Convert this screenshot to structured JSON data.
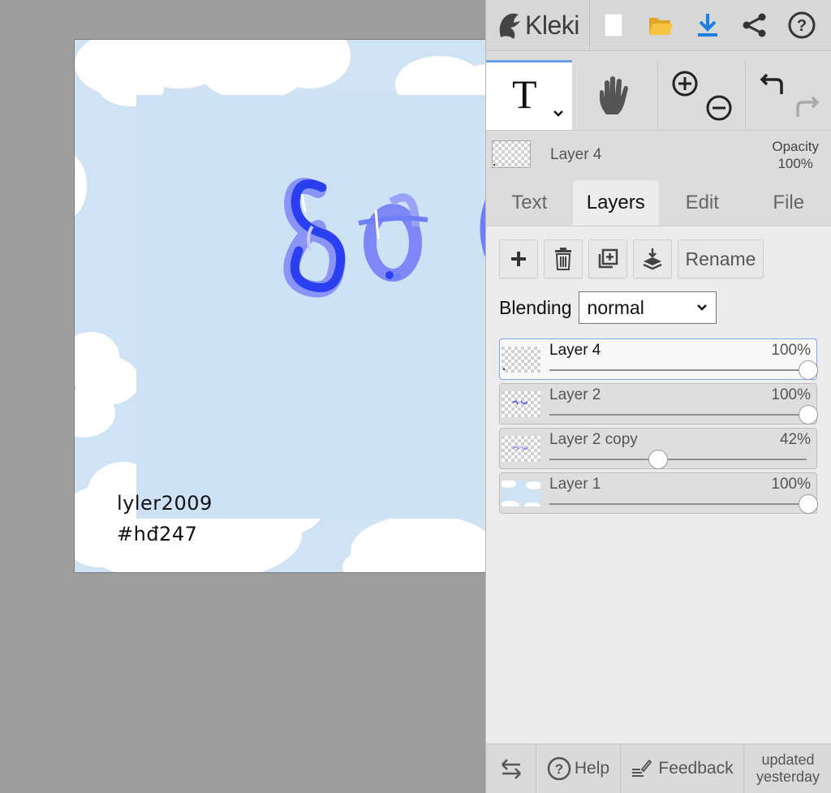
{
  "app": {
    "name": "Kleki"
  },
  "canvas": {
    "signature_line1": "lyler2009",
    "signature_line2": "#hđ247",
    "background_color": "#cfe3f5"
  },
  "toolbar": {
    "icons": [
      "new-image-icon",
      "open-folder-icon",
      "download-icon",
      "share-icon",
      "help-icon"
    ]
  },
  "tools": {
    "active": "text",
    "icons": [
      "text-tool-icon",
      "hand-tool-icon",
      "zoom-in-icon",
      "zoom-out-icon",
      "undo-icon",
      "redo-icon"
    ]
  },
  "current_layer": {
    "name": "Layer 4",
    "opacity_label": "Opacity",
    "opacity_value": "100%"
  },
  "tabs": [
    {
      "label": "Text",
      "active": false
    },
    {
      "label": "Layers",
      "active": true
    },
    {
      "label": "Edit",
      "active": false
    },
    {
      "label": "File",
      "active": false
    }
  ],
  "layers_panel": {
    "actions": [
      "add-layer-icon",
      "delete-layer-icon",
      "duplicate-layer-icon",
      "merge-down-icon"
    ],
    "rename_label": "Rename",
    "blending_label": "Blending",
    "blending_value": "normal",
    "layers": [
      {
        "name": "Layer 4",
        "opacity": "100%",
        "opacity_fraction": 1.0,
        "selected": true
      },
      {
        "name": "Layer 2",
        "opacity": "100%",
        "opacity_fraction": 1.0,
        "selected": false
      },
      {
        "name": "Layer 2 copy",
        "opacity": "42%",
        "opacity_fraction": 0.42,
        "selected": false
      },
      {
        "name": "Layer 1",
        "opacity": "100%",
        "opacity_fraction": 1.0,
        "selected": false
      }
    ]
  },
  "bottom_bar": {
    "help_label": "Help",
    "feedback_label": "Feedback",
    "updated_line1": "updated",
    "updated_line2": "yesterday"
  },
  "colors": {
    "accent": "#6aa0e6",
    "art_blue": "#2a3ff0",
    "panel_bg": "#dcdcdc"
  }
}
